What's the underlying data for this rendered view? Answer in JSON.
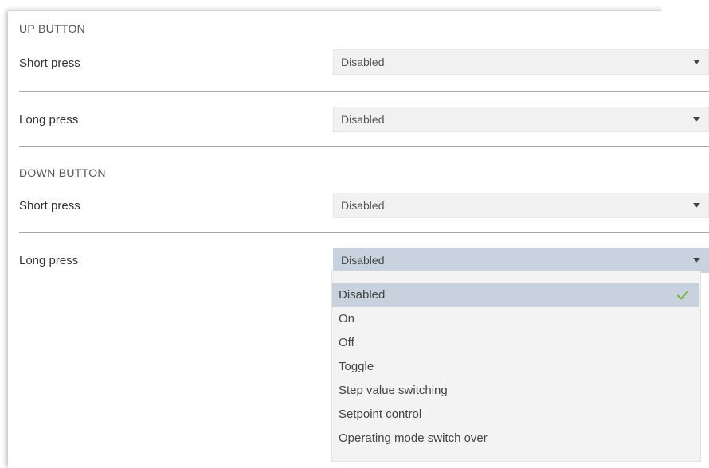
{
  "up_section": {
    "title": "UP BUTTON",
    "short_press": {
      "label": "Short press",
      "value": "Disabled"
    },
    "long_press": {
      "label": "Long press",
      "value": "Disabled"
    }
  },
  "down_section": {
    "title": "DOWN BUTTON",
    "short_press": {
      "label": "Short press",
      "value": "Disabled"
    },
    "long_press": {
      "label": "Long press",
      "value": "Disabled"
    }
  },
  "dropdown": {
    "options": [
      "Disabled",
      "On",
      "Off",
      "Toggle",
      "Step value switching",
      "Setpoint control",
      "Operating mode switch over"
    ],
    "selected": "Disabled"
  },
  "colors": {
    "selected_bg": "#c8d2de",
    "check": "#7ab648",
    "select_bg": "#f1f1f1"
  },
  "icons": {
    "caret": "chevron-down-icon",
    "check": "check-icon"
  }
}
